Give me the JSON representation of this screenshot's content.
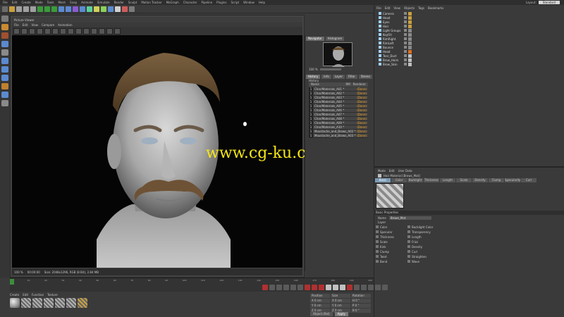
{
  "menubar": {
    "items": [
      "File",
      "Edit",
      "Create",
      "Mode",
      "Tools",
      "Mesh",
      "Snap",
      "Animate",
      "Simulate",
      "Render",
      "Sculpt",
      "Motion Tracker",
      "MoGraph",
      "Character",
      "Pipeline",
      "Plugins",
      "Script",
      "Window",
      "Help"
    ],
    "layout_label": "Layout:",
    "layout_value": "Standard"
  },
  "toolbar": {
    "icon_colors": [
      "#6b6b6b",
      "#c9a040",
      "#a0a0a0",
      "#a0a0a0",
      "#a0a0a0",
      "#3a9b3a",
      "#3a9b3a",
      "#3a9b3a",
      "#5b8ad0",
      "#5b8ad0",
      "#8a5bd0",
      "#5b8ad0",
      "#5bd09b",
      "#cfcf5b",
      "#8ad05b",
      "#5b8ad0",
      "#d0d0d0",
      "#d05b5b",
      "#7a7a7a"
    ]
  },
  "lefttools": {
    "icon_colors": [
      "#7a7a7a",
      "#c98a30",
      "#a05030",
      "#5b8ad0",
      "#8a8a8a",
      "#5b8ad0",
      "#5b8ad0",
      "#5b8ad0",
      "#c08030",
      "#5b8ad0",
      "#8a8a8a"
    ]
  },
  "viewport": {
    "title": "Picture Viewer",
    "menu": [
      "File",
      "Edit",
      "View",
      "Compare",
      "Animation"
    ],
    "status_zoom": "100 %",
    "status_time": "00:00:00",
    "status_info": "Size: 2048x1296, RGB (8 Bit), 2.84 MB"
  },
  "watermark": "www.cg-ku.com",
  "navigator": {
    "tabs": [
      "Navigator",
      "Histogram"
    ],
    "zoom": "100 %",
    "history_tabs": [
      "History",
      "Info",
      "Layer",
      "Filter",
      "Stereo"
    ],
    "history_title": "History",
    "col_name": "Name",
    "col_rm": "RM",
    "col_status": "Renderer",
    "rows": [
      {
        "num": "1",
        "name": "Char/Materials_A01 *",
        "status": "(Done)"
      },
      {
        "num": "1",
        "name": "Char/Materials_A02 *",
        "status": "(Done)"
      },
      {
        "num": "1",
        "name": "Char/Materials_A03 *",
        "status": "(Done)"
      },
      {
        "num": "1",
        "name": "Char/Materials_A04 *",
        "status": "(Done)"
      },
      {
        "num": "1",
        "name": "Char/Materials_A05 *",
        "status": "(Done)"
      },
      {
        "num": "1",
        "name": "Char/Materials_A06 *",
        "status": "(Done)"
      },
      {
        "num": "1",
        "name": "Char/Materials_A07 *",
        "status": "(Done)"
      },
      {
        "num": "1",
        "name": "Char/Materials_A08 *",
        "status": "(Done)"
      },
      {
        "num": "1",
        "name": "Char/Materials_A09 *",
        "status": "(Done)"
      },
      {
        "num": "1",
        "name": "Char/Materials_A10 *",
        "status": "(Done)"
      },
      {
        "num": "1",
        "name": "Moustache_and_Brows_A02 *",
        "status": "(Done)"
      },
      {
        "num": "1",
        "name": "Moustache_and_Brows_A03 *",
        "status": "(Done)"
      }
    ]
  },
  "objects": {
    "menu": [
      "File",
      "Edit",
      "View",
      "Objects",
      "Tags",
      "Bookmarks"
    ],
    "rows": [
      {
        "name": "Camera",
        "tag": "#c9a040"
      },
      {
        "name": "Head",
        "tag": "#c9a040"
      },
      {
        "name": "Eyes",
        "tag": "#c9a040"
      },
      {
        "name": "Hair",
        "tag": "#c9a040"
      },
      {
        "name": "Light Groups",
        "tag": "#8a8a8a"
      },
      {
        "name": "KeyFill",
        "tag": "#8a8a8a"
      },
      {
        "name": "RimRight",
        "tag": "#8a8a8a"
      },
      {
        "name": "RimLeft",
        "tag": "#8a8a8a"
      },
      {
        "name": "Bounce",
        "tag": "#8a8a8a"
      },
      {
        "name": "Head",
        "tag": "#e07020"
      },
      {
        "name": "Tear_Duct",
        "tag": "#c0c0c0"
      },
      {
        "name": "Brow_Hairs",
        "tag": "#c0c0c0"
      },
      {
        "name": "Brow_Skin",
        "tag": "#c0c0c0"
      }
    ]
  },
  "material_editor": {
    "menu": [
      "Mode",
      "Edit",
      "User Data"
    ],
    "name": "Hair Material [Brows_Mat]",
    "tabs": [
      "Basic",
      "Color",
      "Backlight",
      "Thickness",
      "Length",
      "Scale",
      "Density",
      "Clump",
      "Specularity",
      "Curl"
    ],
    "active_tab": "Basic",
    "section": "Basic Properties",
    "name_label": "Name",
    "name_value": "Brows_Mat",
    "layer_label": "Layer",
    "props": [
      "Color",
      "Backlight Color",
      "Specular",
      "Transparency",
      "Thickness",
      "Length",
      "Scale",
      "Frizz",
      "Kink",
      "Density",
      "Clump",
      "Curl",
      "Twist",
      "Straighten",
      "Bend",
      "Wave"
    ]
  },
  "timeline": {
    "ticks": [
      "0",
      "10",
      "20",
      "30",
      "40",
      "50",
      "60",
      "70",
      "80",
      "90",
      "100",
      "110",
      "120",
      "130",
      "140",
      "150",
      "160",
      "170",
      "180",
      "190",
      "200"
    ],
    "controls": [
      "#b03030",
      "#5a5a5a",
      "#5a5a5a",
      "#5a5a5a",
      "#5a5a5a",
      "#5a5a5a",
      "#b03030",
      "#b03030",
      "#b03030",
      "#c0c0c0",
      "#c0c0c0",
      "#c0c0c0",
      "#b03030",
      "#5a5a5a",
      "#5a5a5a",
      "#5a5a5a",
      "#5a5a5a",
      "#5a5a5a"
    ]
  },
  "material_manager": {
    "menu": [
      "Create",
      "Edit",
      "Function",
      "Texture"
    ],
    "swatches": [
      "#a0a0a0",
      "#b0b0b0",
      "#b0b0b0",
      "#b0b0b0",
      "#b0b0b0",
      "#b0b0b0",
      "#c9a040"
    ]
  },
  "coordinates": {
    "labels": [
      "Position",
      "Size",
      "Rotation"
    ],
    "values": [
      "X 0 cm",
      "X 0 cm",
      "H 0 °",
      "Y 0 cm",
      "Y 0 cm",
      "P 0 °",
      "Z 0 cm",
      "Z 0 cm",
      "B 0 °"
    ],
    "mode": "Object (Rel)",
    "apply": "Apply"
  }
}
